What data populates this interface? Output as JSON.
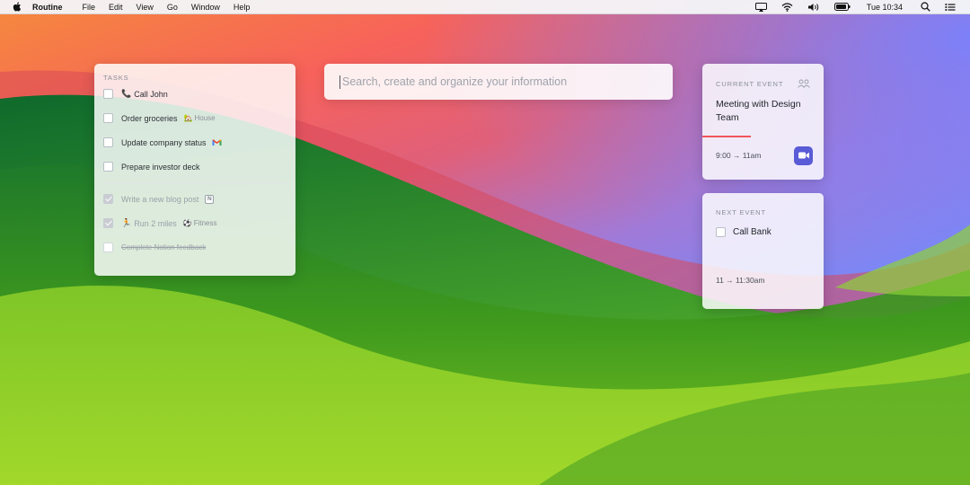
{
  "menubar": {
    "app_name": "Routine",
    "menus": [
      "File",
      "Edit",
      "View",
      "Go",
      "Window",
      "Help"
    ],
    "clock": "Tue 10:34",
    "status_icons": [
      "airplay-icon",
      "wifi-icon",
      "volume-icon",
      "battery-icon",
      "spotlight-search-icon",
      "control-center-icon"
    ]
  },
  "tasks": {
    "heading": "TASKS",
    "open": [
      {
        "label": "Call John",
        "emoji": "📞",
        "done": false
      },
      {
        "label": "Order groceries",
        "tag_emoji": "🏡",
        "tag": "House",
        "done": false
      },
      {
        "label": "Update company status",
        "icon": "gmail-icon",
        "done": false
      },
      {
        "label": "Prepare investor deck",
        "done": false
      }
    ],
    "completed": [
      {
        "label": "Write a new blog post",
        "icon": "notion-icon",
        "icon_text": "N",
        "done": true
      },
      {
        "label": "Run 2 miles",
        "emoji": "🏃",
        "tag_emoji": "⚽",
        "tag": "Fitness",
        "done": true
      },
      {
        "label": "Complete Notion feedback",
        "done": false,
        "strikethrough": true
      }
    ]
  },
  "search": {
    "placeholder": "Search, create and organize your information",
    "value": ""
  },
  "current_event": {
    "heading": "CURRENT EVENT",
    "title": "Meeting with Design Team",
    "time": "9:00 → 11am",
    "progress": 0.4,
    "video_icon": "video-camera-icon",
    "attendees_icon": "people-icon"
  },
  "next_event": {
    "heading": "NEXT EVENT",
    "title": "Call Bank",
    "time": "11 → 11:30am"
  },
  "colors": {
    "accent_red": "#f2555a",
    "zoom_button": "#5a5bd6"
  }
}
